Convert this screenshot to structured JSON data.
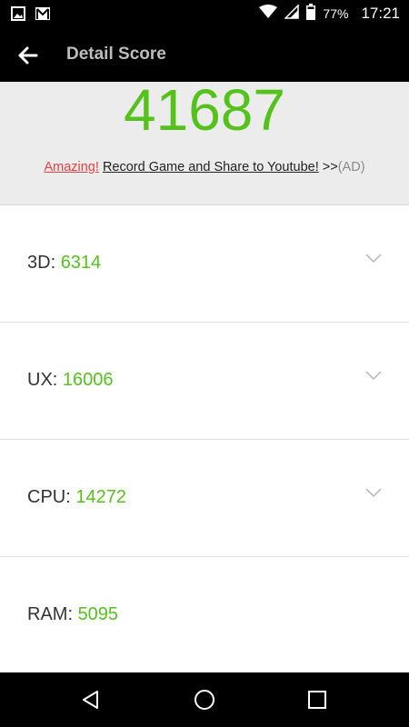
{
  "status_bar": {
    "icons_left": [
      "image-icon",
      "gmail-icon"
    ],
    "icons_right": [
      "wifi-icon",
      "signal-icon",
      "battery-icon"
    ],
    "battery": "77%",
    "time": "17:21"
  },
  "app_bar": {
    "title": "Detail Score",
    "back_icon": "arrow-left-icon"
  },
  "score": {
    "total": "41687"
  },
  "promo": {
    "amazing": "Amazing!",
    "record": "Record Game and Share to Youtube!",
    "arrows": ">>",
    "ad": "(AD)"
  },
  "rows": [
    {
      "label": "3D:",
      "value": "6314",
      "expandable": true
    },
    {
      "label": "UX:",
      "value": "16006",
      "expandable": true
    },
    {
      "label": "CPU:",
      "value": "14272",
      "expandable": true
    },
    {
      "label": "RAM:",
      "value": "5095",
      "expandable": false
    }
  ],
  "nav_bar": {
    "icons": [
      "back-triangle-icon",
      "home-circle-icon",
      "recents-square-icon"
    ]
  },
  "colors": {
    "score_green": "#55c21b",
    "amazing_red": "#e84141",
    "bars_black": "#000000",
    "panel_gray": "#ececec"
  }
}
